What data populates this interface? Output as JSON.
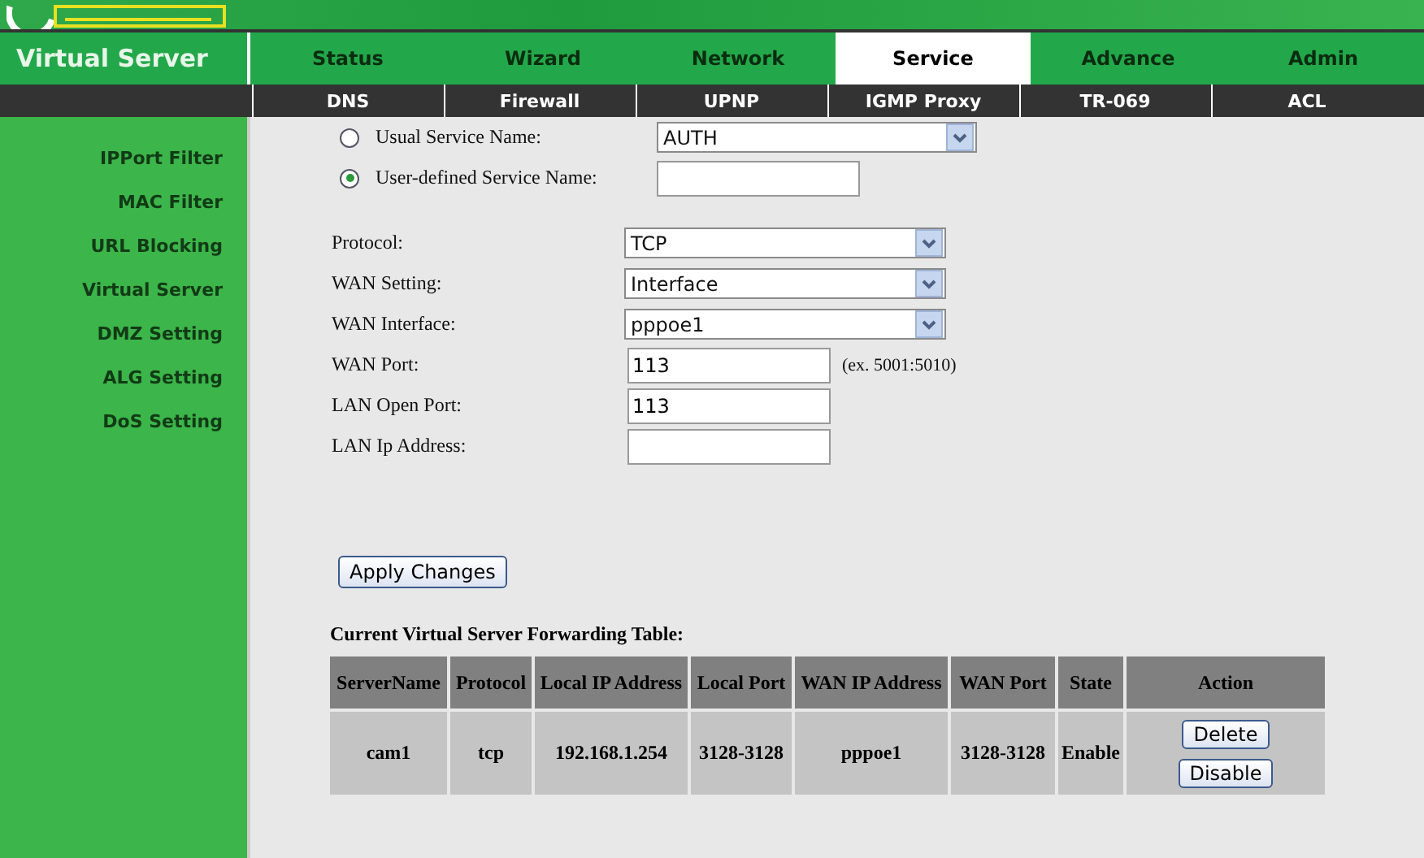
{
  "section_title": "Virtual Server",
  "main_tabs": [
    {
      "label": "Status",
      "selected": false
    },
    {
      "label": "Wizard",
      "selected": false
    },
    {
      "label": "Network",
      "selected": false
    },
    {
      "label": "Service",
      "selected": true
    },
    {
      "label": "Advance",
      "selected": false
    },
    {
      "label": "Admin",
      "selected": false
    }
  ],
  "sub_tabs": [
    {
      "label": "DNS",
      "selected": false
    },
    {
      "label": "Firewall",
      "selected": false
    },
    {
      "label": "UPNP",
      "selected": false
    },
    {
      "label": "IGMP Proxy",
      "selected": false
    },
    {
      "label": "TR-069",
      "selected": false
    },
    {
      "label": "ACL",
      "selected": false
    }
  ],
  "sidebar": {
    "items": [
      {
        "label": "IPPort Filter"
      },
      {
        "label": "MAC Filter"
      },
      {
        "label": "URL Blocking"
      },
      {
        "label": "Virtual Server"
      },
      {
        "label": "DMZ Setting"
      },
      {
        "label": "ALG Setting"
      },
      {
        "label": "DoS Setting"
      }
    ]
  },
  "service_name": [
    {
      "label": "Usual Service Name:",
      "selected": false,
      "kind": "select",
      "value": "AUTH"
    },
    {
      "label": "User-defined Service Name:",
      "selected": true,
      "kind": "text"
    }
  ],
  "fields": [
    {
      "label": "Protocol:",
      "kind": "select",
      "value": "TCP"
    },
    {
      "label": "WAN Setting:",
      "kind": "select",
      "value": "Interface"
    },
    {
      "label": "WAN Interface:",
      "kind": "select",
      "value": "pppoe1"
    },
    {
      "label": "WAN Port:",
      "kind": "text",
      "value": "113",
      "hint": "(ex. 5001:5010)"
    },
    {
      "label": "LAN Open Port:",
      "kind": "text",
      "value": "113"
    },
    {
      "label": "LAN Ip Address:",
      "kind": "text"
    }
  ],
  "apply_button": "Apply Changes",
  "table": {
    "title": "Current Virtual Server Forwarding Table:",
    "columns": [
      "ServerName",
      "Protocol",
      "Local IP Address",
      "Local Port",
      "WAN IP Address",
      "WAN Port",
      "State",
      "Action"
    ],
    "rows": [
      {
        "cells": [
          "cam1",
          "tcp",
          "192.168.1.254",
          "3128-3128",
          "pppoe1",
          "3128-3128",
          "Enable"
        ],
        "actions": [
          "Delete",
          "Disable"
        ]
      }
    ]
  }
}
